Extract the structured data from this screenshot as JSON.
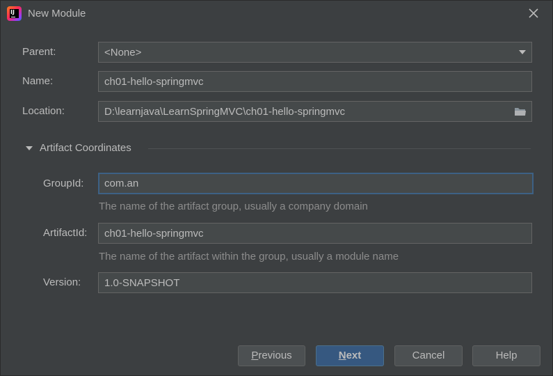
{
  "window": {
    "title": "New Module"
  },
  "form": {
    "parent_label": "Parent:",
    "parent_value": "<None>",
    "name_label": "Name:",
    "name_value": "ch01-hello-springmvc",
    "location_label": "Location:",
    "location_value": "D:\\learnjava\\LearnSpringMVC\\ch01-hello-springmvc"
  },
  "artifact": {
    "section_title": "Artifact Coordinates",
    "groupid_label": "GroupId:",
    "groupid_value": "com.an",
    "groupid_hint": "The name of the artifact group, usually a company domain",
    "artifactid_label": "ArtifactId:",
    "artifactid_value": "ch01-hello-springmvc",
    "artifactid_hint": "The name of the artifact within the group, usually a module name",
    "version_label": "Version:",
    "version_value": "1.0-SNAPSHOT"
  },
  "buttons": {
    "previous_mnemonic": "P",
    "previous_rest": "revious",
    "next_mnemonic": "N",
    "next_rest": "ext",
    "cancel": "Cancel",
    "help": "Help"
  },
  "colors": {
    "accent": "#365880",
    "focus_border": "#3d6185",
    "background": "#3c3f41"
  },
  "icons": {
    "app": "intellij-idea-icon",
    "close": "close-icon",
    "dropdown": "chevron-down-icon",
    "browse": "folder-icon",
    "collapse": "triangle-down-icon"
  }
}
